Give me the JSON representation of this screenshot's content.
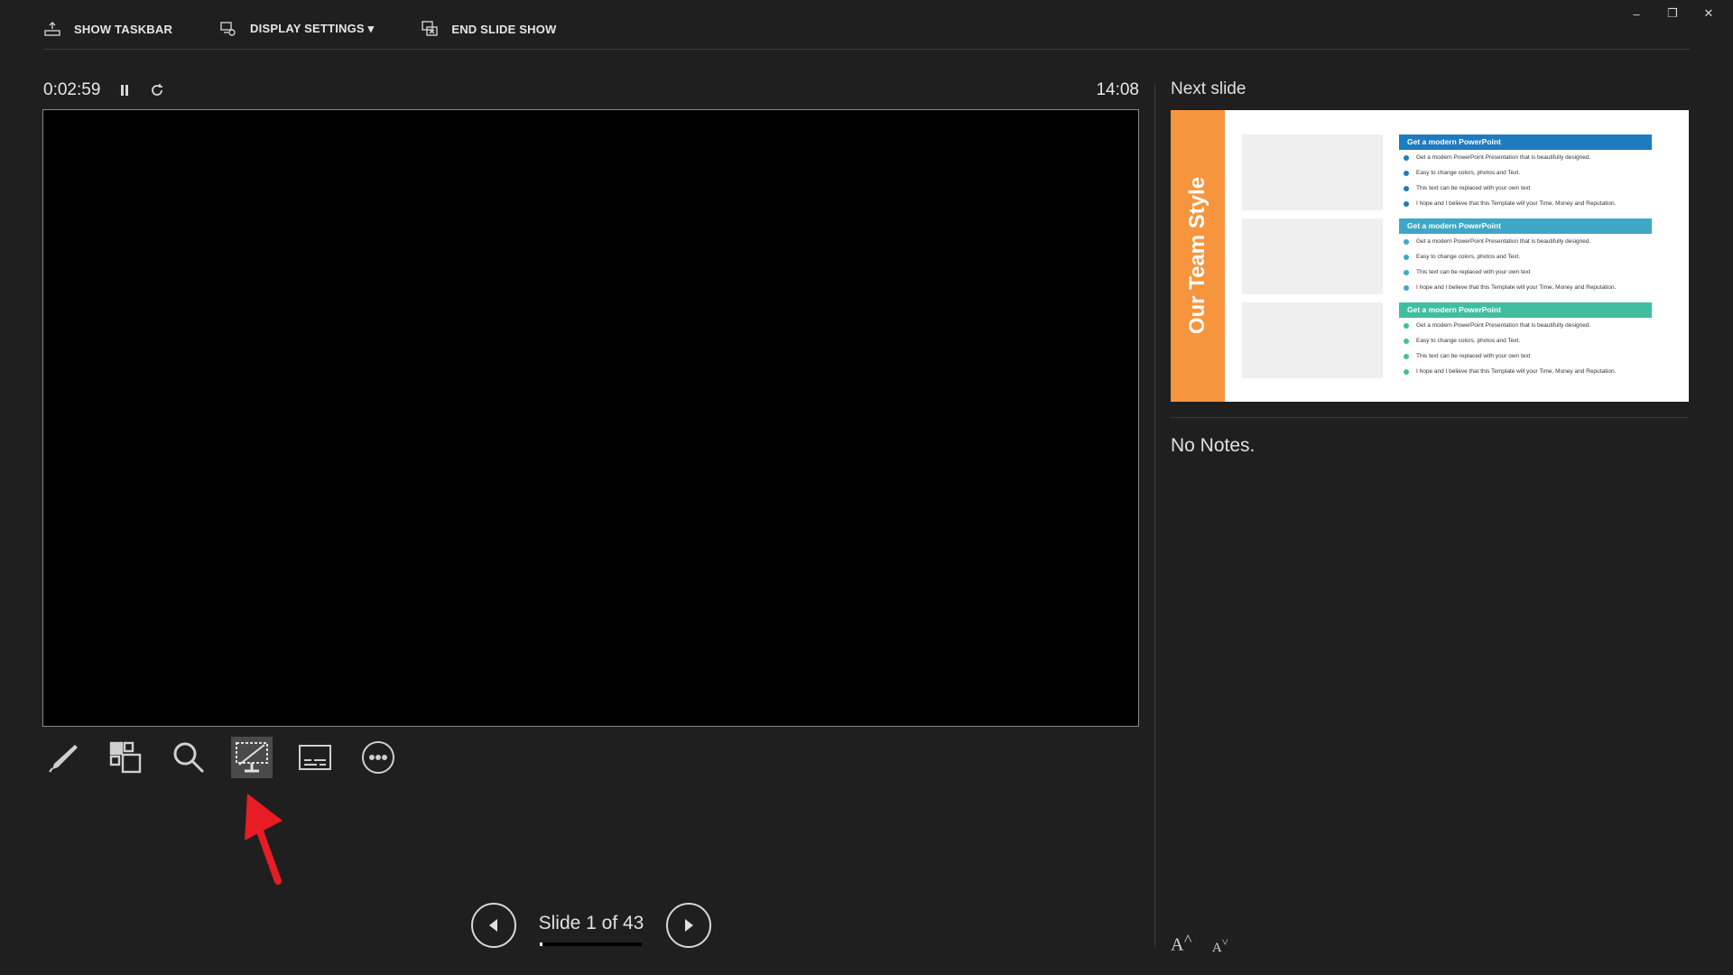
{
  "topbar": {
    "show_taskbar": "SHOW TASKBAR",
    "display_settings": "DISPLAY SETTINGS ▾",
    "end_slide_show": "END SLIDE SHOW"
  },
  "window": {
    "minimize": "–",
    "restore": "❐",
    "close": "✕"
  },
  "timer": {
    "elapsed": "0:02:59",
    "clock": "14:08"
  },
  "navigation": {
    "counter": "Slide 1 of 43",
    "current": 1,
    "total": 43
  },
  "next_slide": {
    "label": "Next slide",
    "title": "Our Team Style",
    "blocks": [
      {
        "heading": "Get a modern PowerPoint",
        "color": "#1e7bbf",
        "bullets": [
          "Get a modern PowerPoint  Presentation that is beautifully designed.",
          "Easy to change colors, photos and Text.",
          "This text can be replaced with your own text",
          "I hope and I believe that this Template will your Time, Money and Reputation."
        ]
      },
      {
        "heading": "Get a modern PowerPoint",
        "color": "#3fa7c6",
        "bullets": [
          "Get a modern PowerPoint  Presentation that is beautifully designed.",
          "Easy to change colors, photos and Text.",
          "This text can be replaced with your own text",
          "I hope and I believe that this Template will your Time, Money and Reputation."
        ]
      },
      {
        "heading": "Get a modern PowerPoint",
        "color": "#3fbf9f",
        "bullets": [
          "Get a modern PowerPoint  Presentation that is beautifully designed.",
          "Easy to change colors, photos and Text.",
          "This text can be replaced with your own text",
          "I hope and I believe that this Template will your Time, Money and Reputation."
        ]
      }
    ]
  },
  "notes": {
    "text": "No Notes."
  },
  "tools": [
    {
      "name": "pen-tool",
      "icon": "pen-icon"
    },
    {
      "name": "see-all-slides",
      "icon": "grid-icon"
    },
    {
      "name": "zoom-into-slide",
      "icon": "magnifier-icon"
    },
    {
      "name": "black-screen",
      "icon": "black-screen-icon",
      "active": true
    },
    {
      "name": "subtitles",
      "icon": "subtitles-icon"
    },
    {
      "name": "more-options",
      "icon": "more-icon"
    }
  ],
  "font_controls": {
    "increase": "A",
    "decrease": "A"
  },
  "colors": {
    "accent_orange": "#f7953e",
    "arrow_red": "#e81c24"
  }
}
